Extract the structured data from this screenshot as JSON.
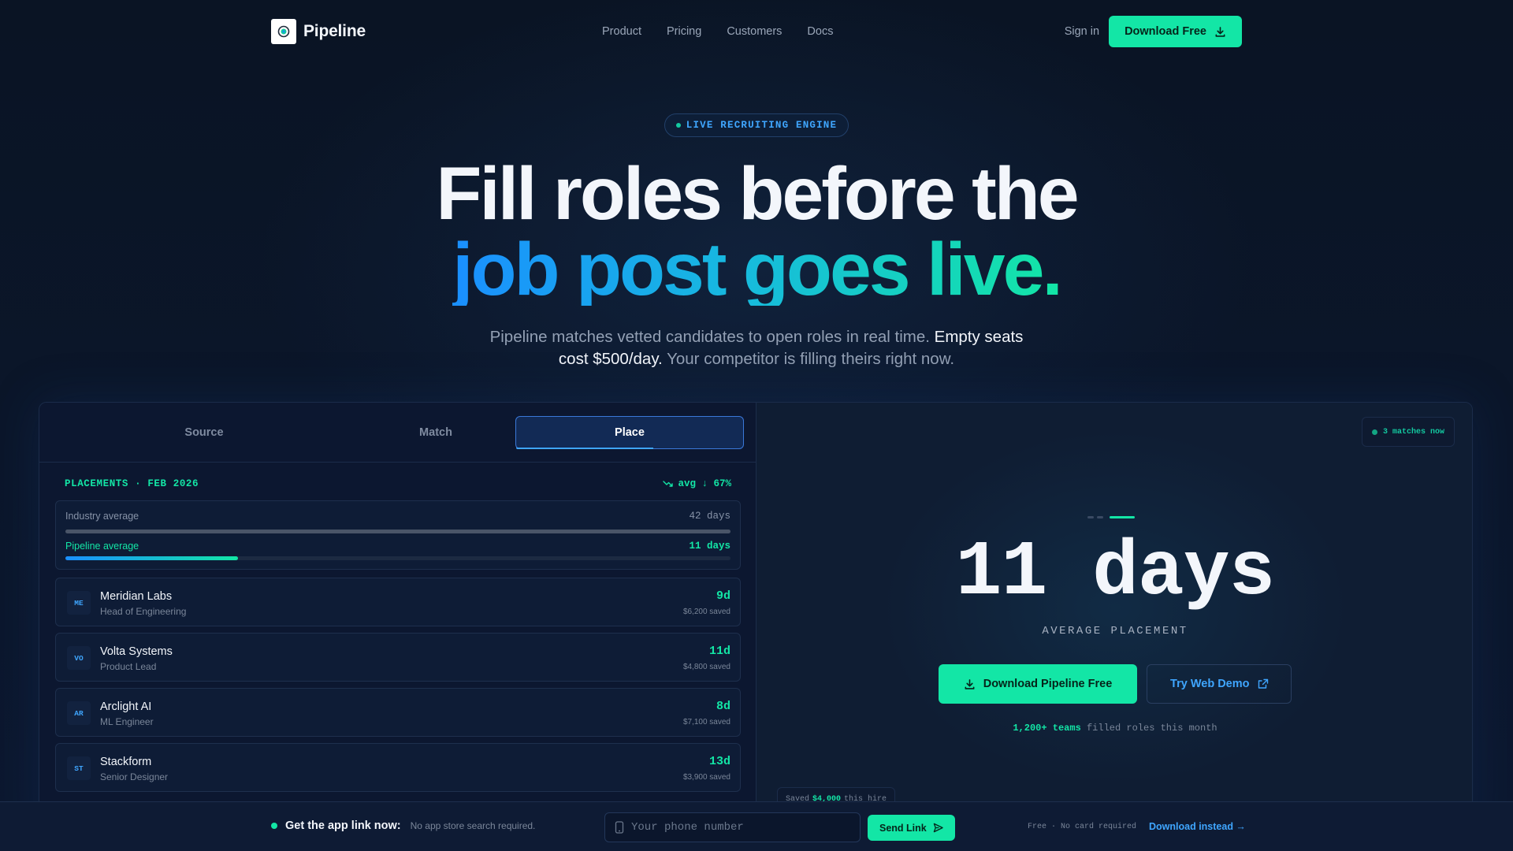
{
  "nav": {
    "brand": "Pipeline",
    "links": [
      "Product",
      "Pricing",
      "Customers",
      "Docs"
    ],
    "signin": "Sign in",
    "download": "Download Free"
  },
  "hero": {
    "pill": "LIVE RECRUITING ENGINE",
    "line1": "Fill roles before the",
    "line2": "job post goes live.",
    "sub_part1": "Pipeline matches vetted candidates to open roles in real time.",
    "sub_highlight": "Empty seats cost $500/day.",
    "sub_part2": "Your competitor is filling theirs right now."
  },
  "tabs": [
    {
      "label": "Source",
      "active": false
    },
    {
      "label": "Match",
      "active": false
    },
    {
      "label": "Place",
      "active": true
    }
  ],
  "placements": {
    "title": "PLACEMENTS · FEB 2026",
    "avg": "avg ↓ 67%",
    "industry_label": "Industry average",
    "industry_value": "42 days",
    "industry_fraction": 1.0,
    "pipeline_label": "Pipeline average",
    "pipeline_value": "11 days",
    "pipeline_fraction": 0.26,
    "items": [
      {
        "initials": "ME",
        "company": "Meridian Labs",
        "role": "Head of Engineering",
        "days": "9d",
        "saved": "$6,200 saved"
      },
      {
        "initials": "VO",
        "company": "Volta Systems",
        "role": "Product Lead",
        "days": "11d",
        "saved": "$4,800 saved"
      },
      {
        "initials": "AR",
        "company": "Arclight AI",
        "role": "ML Engineer",
        "days": "8d",
        "saved": "$7,100 saved"
      },
      {
        "initials": "ST",
        "company": "Stackform",
        "role": "Senior Designer",
        "days": "13d",
        "saved": "$3,900 saved"
      }
    ]
  },
  "stat": {
    "badge": "3 matches now",
    "value": "11 days",
    "label": "AVERAGE PLACEMENT",
    "cta_primary": "Download Pipeline Free",
    "cta_secondary": "Try Web Demo",
    "teams_bold": "1,200+ teams",
    "teams_rest": "filled roles this month",
    "chip_prefix": "Saved",
    "chip_amount": "$4,000",
    "chip_suffix": "this hire"
  },
  "bottom": {
    "title": "Get the app link now:",
    "sub": "No app store search required.",
    "phone_placeholder": "Your phone number",
    "send": "Send Link",
    "free": "Free · No card required",
    "download_instead": "Download instead →"
  },
  "colors": {
    "accent_green": "#13e6a6",
    "accent_blue": "#3fa6ff",
    "background": "#0b1527"
  }
}
